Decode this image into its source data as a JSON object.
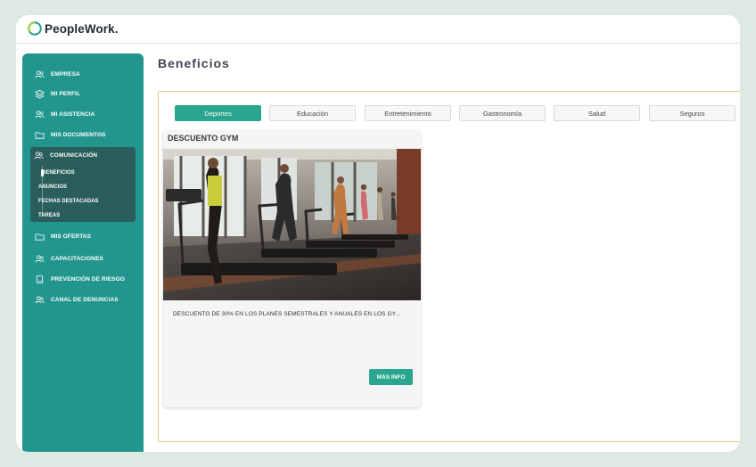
{
  "header": {
    "brand": "PeopleWork."
  },
  "sidebar": {
    "items": [
      {
        "label": "EMPRESA",
        "icon": "users-icon"
      },
      {
        "label": "MI PERFIL",
        "icon": "layers-icon"
      },
      {
        "label": "MI ASISTENCIA",
        "icon": "users-icon"
      },
      {
        "label": "MIS DOCUMENTOS",
        "icon": "folder-icon"
      },
      {
        "label": "COMUNICACIÓN",
        "icon": "users-icon"
      },
      {
        "label": "MIS OFERTAS",
        "icon": "folder-icon"
      },
      {
        "label": "CAPACITACIONES",
        "icon": "users-icon"
      },
      {
        "label": "PREVENCIÓN DE RIESGO",
        "icon": "book-icon"
      },
      {
        "label": "CANAL DE DENUNCIAS",
        "icon": "users-icon"
      }
    ],
    "communication_sub": [
      "BENEFICIOS",
      "ANUNCIOS",
      "FECHAS DESTACADAS",
      "TAREAS"
    ],
    "accent": "#22968e"
  },
  "main": {
    "title": "Beneficios",
    "tabs": [
      "Deportes",
      "Educación",
      "Entretenimiento",
      "Gastronomía",
      "Salud",
      "Seguros"
    ],
    "active_tab": "Deportes",
    "card": {
      "title": "DESCUENTO GYM",
      "description": "DESCUENTO DE 30% EN LOS PLANES SEMESTRALES Y ANUALES EN LOS GY...",
      "button": "MÁS INFO"
    },
    "accent": "#2aa58f"
  }
}
